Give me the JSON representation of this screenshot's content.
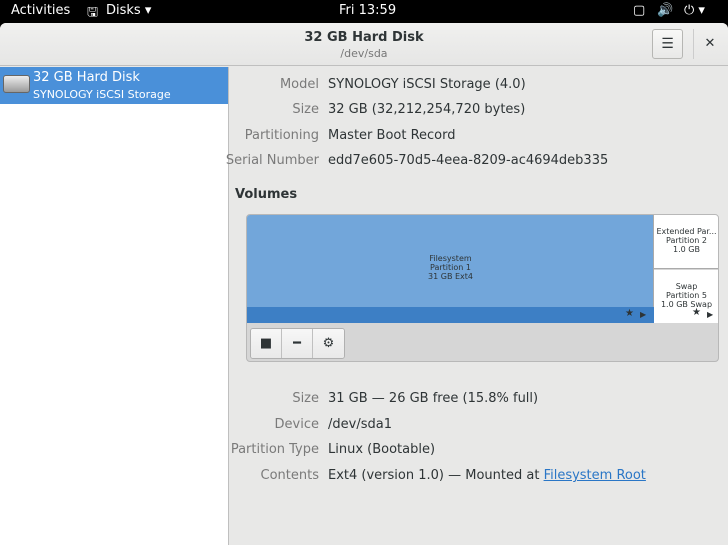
{
  "topbar": {
    "activities": "Activities",
    "app": "Disks",
    "clock": "Fri 13:59"
  },
  "header": {
    "title": "32 GB Hard Disk",
    "subtitle": "/dev/sda"
  },
  "sidebar": {
    "items": [
      {
        "name": "32 GB Hard Disk",
        "desc": "SYNOLOGY iSCSI Storage"
      }
    ]
  },
  "disk": [
    {
      "label": "Model",
      "value": "SYNOLOGY iSCSI Storage (4.0)"
    },
    {
      "label": "Size",
      "value": "32 GB (32,212,254,720 bytes)"
    },
    {
      "label": "Partitioning",
      "value": "Master Boot Record"
    },
    {
      "label": "Serial Number",
      "value": "edd7e605-70d5-4eea-8209-ac4694deb335"
    }
  ],
  "volumes": {
    "heading": "Volumes",
    "p1": [
      "Filesystem",
      "Partition 1",
      "31 GB Ext4"
    ],
    "p2": [
      "Extended Par...",
      "Partition 2",
      "1.0 GB"
    ],
    "p5": [
      "Swap",
      "Partition 5",
      "1.0 GB Swap"
    ]
  },
  "details": [
    {
      "label": "Size",
      "value": "31 GB — 26 GB free (15.8% full)"
    },
    {
      "label": "Device",
      "value": "/dev/sda1"
    },
    {
      "label": "Partition Type",
      "value": "Linux (Bootable)"
    }
  ],
  "contents": {
    "label": "Contents",
    "prefix": "Ext4 (version 1.0) — Mounted at ",
    "link": "Filesystem Root"
  }
}
